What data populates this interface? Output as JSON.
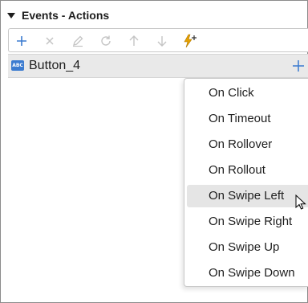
{
  "panel": {
    "title": "Events - Actions"
  },
  "toolbar": {
    "buttons": [
      {
        "icon": "plus-icon",
        "enabled": true
      },
      {
        "icon": "close-icon",
        "enabled": false
      },
      {
        "icon": "pencil-icon",
        "enabled": false
      },
      {
        "icon": "refresh-icon",
        "enabled": false
      },
      {
        "icon": "arrow-up-icon",
        "enabled": false
      },
      {
        "icon": "arrow-down-icon",
        "enabled": false
      },
      {
        "icon": "lightning-plus-icon",
        "enabled": true
      }
    ]
  },
  "row": {
    "icon": "button-widget-icon",
    "icon_text": "ABC",
    "label": "Button_4"
  },
  "menu": {
    "items": [
      {
        "label": "On Click"
      },
      {
        "label": "On Timeout"
      },
      {
        "label": "On Rollover"
      },
      {
        "label": "On Rollout"
      },
      {
        "label": "On Swipe Left",
        "hovered": true
      },
      {
        "label": "On Swipe Right"
      },
      {
        "label": "On Swipe Up"
      },
      {
        "label": "On Swipe Down"
      }
    ]
  },
  "colors": {
    "accent": "#3b7bd0",
    "disabled": "#c4c4c4",
    "lightning": "#e6a100",
    "hover": "#e5e5e5",
    "row_bg": "#e9e9e9"
  }
}
